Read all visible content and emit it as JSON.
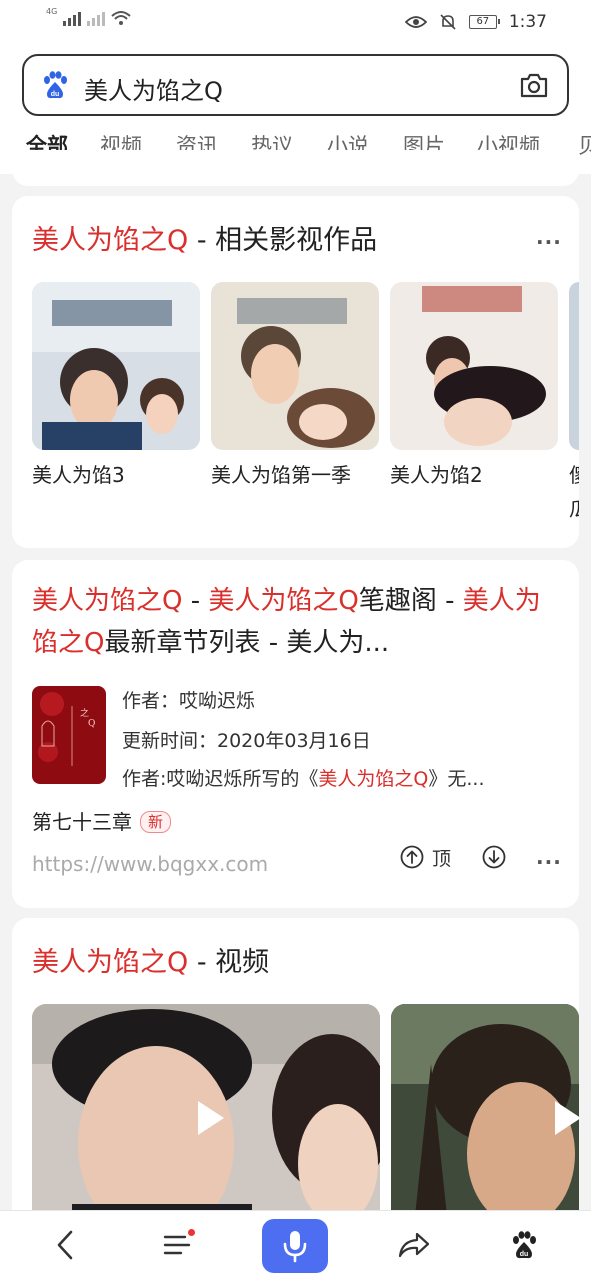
{
  "status_bar": {
    "network_tag": "4G",
    "battery": "67",
    "time": "1:37"
  },
  "search": {
    "query": "美人为馅之Q"
  },
  "tabs": [
    "全部",
    "视频",
    "资讯",
    "热议",
    "小说",
    "图片",
    "小视频",
    "贝"
  ],
  "films_card": {
    "title_highlight": "美人为馅之Q",
    "title_rest": " - 相关影视作品",
    "items": [
      {
        "name": "美人为馅3"
      },
      {
        "name": "美人为馅第一季"
      },
      {
        "name": "美人为馅2"
      },
      {
        "name": "傻瓜"
      }
    ]
  },
  "book_card": {
    "title_parts": [
      "美人为馅之Q",
      " - ",
      "美人为馅之Q",
      "笔趣阁 - ",
      "美人为馅之Q",
      "最新章节列表 - 美人为..."
    ],
    "author": "作者：哎呦迟烁",
    "updated": "更新时间：2020年03月16日",
    "desc_prefix": "作者:哎呦迟烁所写的《",
    "desc_highlight": "美人为馅之Q",
    "desc_suffix": "》无...",
    "latest_chapter": "第七十三章",
    "new_badge": "新",
    "url": "https://www.bqgxx.com",
    "top_label": "顶"
  },
  "video_card": {
    "title_highlight": "美人为馅之Q",
    "title_rest": " - 视频"
  },
  "colors": {
    "accent": "#4e6ef2",
    "highlight": "#d9302d"
  },
  "icons": [
    "search-engine-logo-icon",
    "camera-icon",
    "more-icon",
    "thumbs-up-icon",
    "thumbs-down-icon",
    "play-icon",
    "back-icon",
    "menu-icon",
    "microphone-icon",
    "share-icon",
    "paw-icon"
  ]
}
